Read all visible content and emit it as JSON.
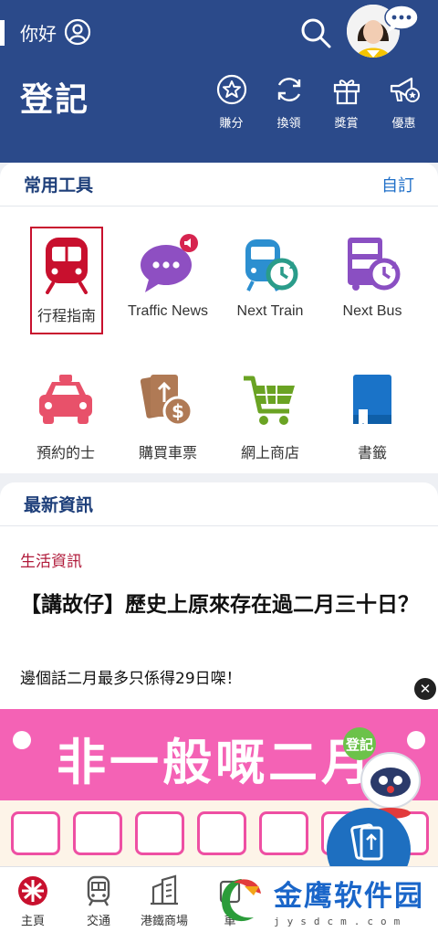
{
  "header": {
    "greeting": "你好",
    "login_label": "登記",
    "actions": [
      {
        "label": "賺分",
        "icon": "star-badge-icon"
      },
      {
        "label": "換領",
        "icon": "refresh-icon"
      },
      {
        "label": "獎賞",
        "icon": "gift-icon"
      },
      {
        "label": "優惠",
        "icon": "megaphone-icon"
      }
    ]
  },
  "tools": {
    "title": "常用工具",
    "customize_label": "自訂",
    "items": [
      {
        "label": "行程指南",
        "icon": "train-front-icon",
        "selected": true
      },
      {
        "label": "Traffic News",
        "icon": "chat-bubble-icon"
      },
      {
        "label": "Next Train",
        "icon": "next-train-icon"
      },
      {
        "label": "Next Bus",
        "icon": "next-bus-icon"
      },
      {
        "label": "預約的士",
        "icon": "taxi-icon"
      },
      {
        "label": "購買車票",
        "icon": "ticket-dollar-icon"
      },
      {
        "label": "網上商店",
        "icon": "shopping-cart-icon"
      },
      {
        "label": "書籤",
        "icon": "bookmark-icon"
      }
    ]
  },
  "news": {
    "title": "最新資訊",
    "category": "生活資訊",
    "headline": "【講故仔】歷史上原來存在過二月三十日？",
    "summary": "邊個話二月最多只係得29日㗎！"
  },
  "banner": {
    "text": "非一般嘅二月",
    "mascot_badge": "登記"
  },
  "bottom_nav": [
    {
      "label": "主頁",
      "icon": "mtr-logo-icon"
    },
    {
      "label": "交通",
      "icon": "train-icon"
    },
    {
      "label": "港鐵商場",
      "icon": "building-icon"
    },
    {
      "label": "車",
      "icon": "partial-icon"
    }
  ],
  "watermark": {
    "text": "金鹰软件园",
    "sub": "jysdcm.com"
  },
  "colors": {
    "header_bg": "#2b4a8a",
    "accent_red": "#c8102e",
    "banner_pink": "#f462b5",
    "link_blue": "#1f6fc8"
  }
}
